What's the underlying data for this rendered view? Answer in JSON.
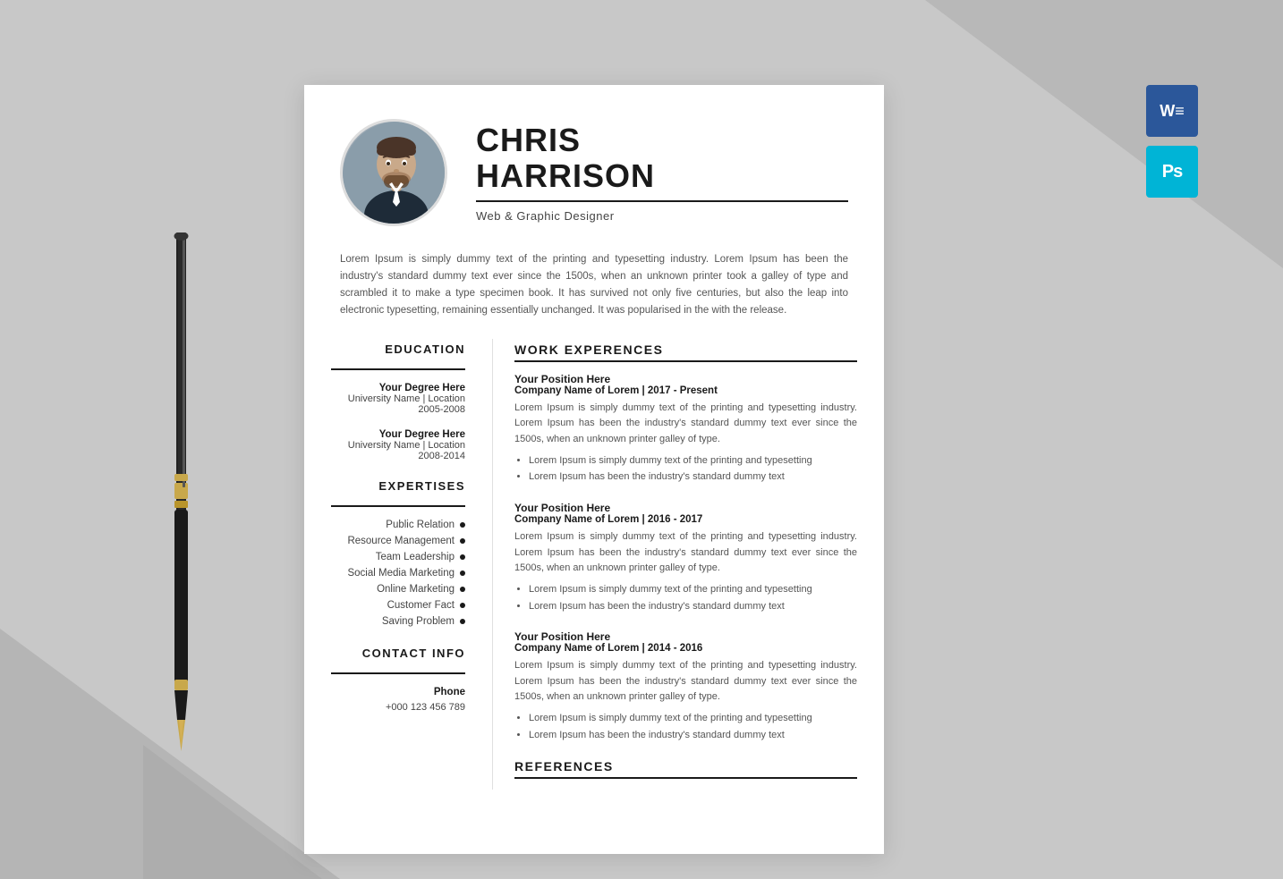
{
  "background": {
    "color": "#c8c8c8"
  },
  "app_icons": [
    {
      "id": "word",
      "label": "W",
      "bg": "#2b579a",
      "title": "Microsoft Word"
    },
    {
      "id": "ps",
      "label": "Ps",
      "bg": "#00b4d6",
      "title": "Adobe Photoshop"
    }
  ],
  "resume": {
    "name_line1": "CHRIS",
    "name_line2": "HARRISON",
    "title": "Web & Graphic Designer",
    "summary": "Lorem Ipsum is simply dummy text of the printing and typesetting industry. Lorem Ipsum has been the industry's standard dummy text ever since the 1500s, when an unknown printer took a galley of type and scrambled it to make a type specimen book. It has survived not only five centuries, but also the leap into electronic typesetting, remaining essentially unchanged. It was popularised in the with the release.",
    "education": {
      "section_title": "EDUCATION",
      "entries": [
        {
          "degree": "Your Degree Here",
          "school": "University Name | Location",
          "years": "2005-2008"
        },
        {
          "degree": "Your Degree Here",
          "school": "University Name | Location",
          "years": "2008-2014"
        }
      ]
    },
    "expertises": {
      "section_title": "EXPERTISES",
      "items": [
        "Public Relation",
        "Resource Management",
        "Team Leadership",
        "Social Media Marketing",
        "Online Marketing",
        "Customer Fact",
        "Saving Problem"
      ]
    },
    "contact": {
      "section_title": "CONTACT INFO",
      "phone_label": "Phone",
      "phone": "+000 123 456 789"
    },
    "work": {
      "section_title": "WORK EXPERENCES",
      "entries": [
        {
          "position": "Your Position Here",
          "company": "Company Name of Lorem | 2017 - Present",
          "desc": "Lorem Ipsum is simply dummy text of the printing and typesetting industry. Lorem Ipsum has been the industry's standard dummy text ever since the 1500s, when an unknown printer galley of type.",
          "bullets": [
            "Lorem Ipsum is simply dummy text of the printing and typesetting",
            "Lorem Ipsum has been the industry's standard dummy text"
          ]
        },
        {
          "position": "Your Position Here",
          "company": "Company Name of Lorem | 2016 - 2017",
          "desc": "Lorem Ipsum is simply dummy text of the printing and typesetting industry. Lorem Ipsum has been the industry's standard dummy text ever since the 1500s, when an unknown printer galley of type.",
          "bullets": [
            "Lorem Ipsum is simply dummy text of the printing and typesetting",
            "Lorem Ipsum has been the industry's standard dummy text"
          ]
        },
        {
          "position": "Your Position Here",
          "company": "Company Name of Lorem | 2014 - 2016",
          "desc": "Lorem Ipsum is simply dummy text of the printing and typesetting industry. Lorem Ipsum has been the industry's standard dummy text ever since the 1500s, when an unknown printer galley of type.",
          "bullets": [
            "Lorem Ipsum is simply dummy text of the printing and typesetting",
            "Lorem Ipsum has been the industry's standard dummy text"
          ]
        }
      ]
    },
    "references": {
      "section_title": "REFERENCES"
    }
  }
}
